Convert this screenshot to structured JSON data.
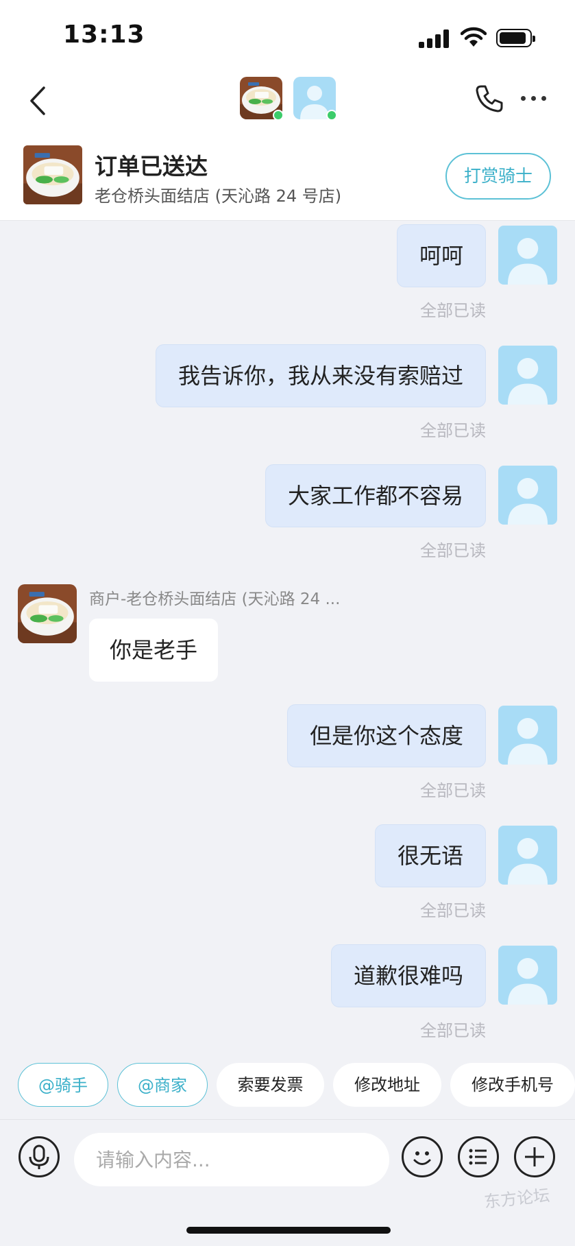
{
  "status_bar": {
    "time": "13:13"
  },
  "nav": {
    "back_icon": "chevron-left-icon",
    "phone_icon": "phone-icon",
    "more_icon": "more-icon"
  },
  "order": {
    "status": "订单已送达",
    "shop": "老仓桥头面结店 (天沁路 24 号店)",
    "tip_button": "打赏骑士"
  },
  "messages": [
    {
      "dir": "out",
      "text": "呵呵",
      "read": "全部已读"
    },
    {
      "dir": "out",
      "text": "我告诉你，我从来没有索赔过",
      "read": "全部已读"
    },
    {
      "dir": "out",
      "text": "大家工作都不容易",
      "read": "全部已读"
    },
    {
      "dir": "in",
      "sender": "商户-老仓桥头面结店 (天沁路 24 ...",
      "text": "你是老手"
    },
    {
      "dir": "out",
      "text": "但是你这个态度",
      "read": "全部已读"
    },
    {
      "dir": "out",
      "text": "很无语",
      "read": "全部已读"
    },
    {
      "dir": "out",
      "text": "道歉很难吗",
      "read": "全部已读"
    }
  ],
  "quick_chips": [
    "@骑手",
    "@商家",
    "索要发票",
    "修改地址",
    "修改手机号"
  ],
  "input": {
    "placeholder": "请输入内容..."
  },
  "watermark": "东方论坛",
  "colors": {
    "accent": "#3bb0c9",
    "bubble_out": "#dfeafb",
    "online": "#3ccc6a",
    "background": "#f1f2f6"
  }
}
